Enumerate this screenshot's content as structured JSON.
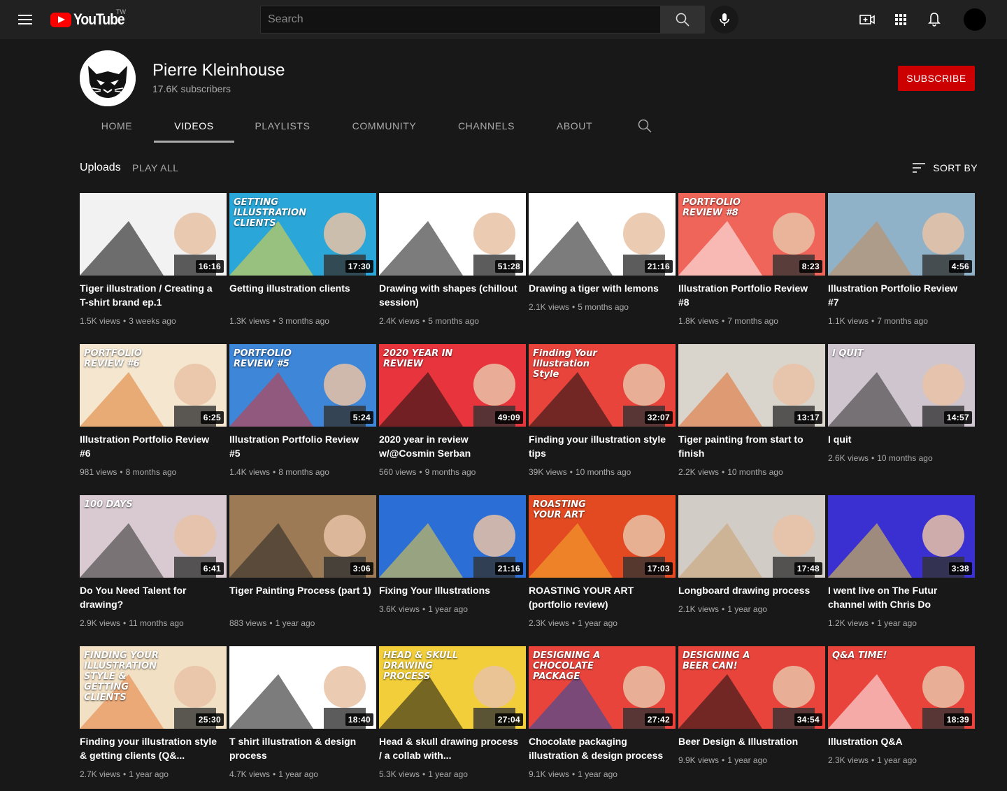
{
  "topbar": {
    "logo_text": "YouTube",
    "region": "TW",
    "search_placeholder": "Search"
  },
  "channel": {
    "name": "Pierre Kleinhouse",
    "subscribers": "17.6K subscribers",
    "subscribe_label": "SUBSCRIBE"
  },
  "tabs": [
    {
      "label": "HOME",
      "active": false
    },
    {
      "label": "VIDEOS",
      "active": true
    },
    {
      "label": "PLAYLISTS",
      "active": false
    },
    {
      "label": "COMMUNITY",
      "active": false
    },
    {
      "label": "CHANNELS",
      "active": false
    },
    {
      "label": "ABOUT",
      "active": false
    }
  ],
  "uploads": {
    "title": "Uploads",
    "play_all": "PLAY ALL",
    "sort_by": "SORT BY"
  },
  "videos": [
    {
      "title": "Tiger illustration / Creating a T-shirt brand ep.1",
      "views": "1.5K views",
      "age": "3 weeks ago",
      "duration": "16:16",
      "thumb_bg": "#f2f2f2",
      "thumb_accent": "#000000",
      "thumb_text": ""
    },
    {
      "title": "Getting illustration clients",
      "views": "1.3K views",
      "age": "3 months ago",
      "duration": "17:30",
      "thumb_bg": "#2aa7d8",
      "thumb_accent": "#f2d636",
      "thumb_text": "GETTING ILLUSTRATION CLIENTS"
    },
    {
      "title": "Drawing with shapes (chillout session)",
      "views": "2.4K views",
      "age": "5 months ago",
      "duration": "51:28",
      "thumb_bg": "#ffffff",
      "thumb_accent": "#111111",
      "thumb_text": ""
    },
    {
      "title": "Drawing a tiger with lemons",
      "views": "2.1K views",
      "age": "5 months ago",
      "duration": "21:16",
      "thumb_bg": "#ffffff",
      "thumb_accent": "#111111",
      "thumb_text": ""
    },
    {
      "title": "Illustration Portfolio Review #8",
      "views": "1.8K views",
      "age": "7 months ago",
      "duration": "8:23",
      "thumb_bg": "#f0655a",
      "thumb_accent": "#ffffff",
      "thumb_text": "PORTFOLIO REVIEW #8"
    },
    {
      "title": "Illustration Portfolio Review #7",
      "views": "1.1K views",
      "age": "7 months ago",
      "duration": "4:56",
      "thumb_bg": "#8fb2c9",
      "thumb_accent": "#c68a55",
      "thumb_text": ""
    },
    {
      "title": "Illustration Portfolio Review #6",
      "views": "981 views",
      "age": "8 months ago",
      "duration": "6:25",
      "thumb_bg": "#f4e6cf",
      "thumb_accent": "#e07a2c",
      "thumb_text": "PORTFOLIO REVIEW #6"
    },
    {
      "title": "Illustration Portfolio Review #5",
      "views": "1.4K views",
      "age": "8 months ago",
      "duration": "5:24",
      "thumb_bg": "#3d86d8",
      "thumb_accent": "#d73434",
      "thumb_text": "PORTFOLIO REVIEW #5"
    },
    {
      "title": "2020 year in review w/@Cosmin Serban",
      "views": "560 views",
      "age": "9 months ago",
      "duration": "49:09",
      "thumb_bg": "#e8343c",
      "thumb_accent": "#111111",
      "thumb_text": "2020 YEAR IN REVIEW"
    },
    {
      "title": "Finding your illustration style tips",
      "views": "39K views",
      "age": "10 months ago",
      "duration": "32:07",
      "thumb_bg": "#e8443c",
      "thumb_accent": "#111111",
      "thumb_text": "Finding Your Illustration Style"
    },
    {
      "title": "Tiger painting from start to finish",
      "views": "2.2K views",
      "age": "10 months ago",
      "duration": "13:17",
      "thumb_bg": "#d9d4cc",
      "thumb_accent": "#e06a2a",
      "thumb_text": ""
    },
    {
      "title": "I quit",
      "views": "2.6K views",
      "age": "10 months ago",
      "duration": "14:57",
      "thumb_bg": "#cfc5cf",
      "thumb_accent": "#2b2b2b",
      "thumb_text": "I QUIT"
    },
    {
      "title": "Do You Need Talent for drawing?",
      "views": "2.9K views",
      "age": "11 months ago",
      "duration": "6:41",
      "thumb_bg": "#d8cad0",
      "thumb_accent": "#2b2b2b",
      "thumb_text": "100 DAYS"
    },
    {
      "title": "Tiger Painting Process (part 1)",
      "views": "883 views",
      "age": "1 year ago",
      "duration": "3:06",
      "thumb_bg": "#9c7a55",
      "thumb_accent": "#222222",
      "thumb_text": ""
    },
    {
      "title": "Fixing Your Illustrations",
      "views": "3.6K views",
      "age": "1 year ago",
      "duration": "21:16",
      "thumb_bg": "#2b6fd6",
      "thumb_accent": "#f2d03c",
      "thumb_text": ""
    },
    {
      "title": "ROASTING YOUR ART (portfolio review)",
      "views": "2.3K views",
      "age": "1 year ago",
      "duration": "17:03",
      "thumb_bg": "#e44a22",
      "thumb_accent": "#f6b030",
      "thumb_text": "ROASTING YOUR ART"
    },
    {
      "title": "Longboard drawing process",
      "views": "2.1K views",
      "age": "1 year ago",
      "duration": "17:48",
      "thumb_bg": "#d2ccc6",
      "thumb_accent": "#caa070",
      "thumb_text": ""
    },
    {
      "title": "I went live on The Futur channel with Chris Do",
      "views": "1.2K views",
      "age": "1 year ago",
      "duration": "3:38",
      "thumb_bg": "#3a2fd0",
      "thumb_accent": "#f3d63a",
      "thumb_text": ""
    },
    {
      "title": "Finding your illustration style & getting clients (Q&...",
      "views": "2.7K views",
      "age": "1 year ago",
      "duration": "25:30",
      "thumb_bg": "#f2e0c4",
      "thumb_accent": "#e57c3a",
      "thumb_text": "FINDING YOUR ILLUSTRATION STYLE & GETTING CLIENTS"
    },
    {
      "title": "T shirt illustration & design process",
      "views": "4.7K views",
      "age": "1 year ago",
      "duration": "18:40",
      "thumb_bg": "#ffffff",
      "thumb_accent": "#111111",
      "thumb_text": ""
    },
    {
      "title": "Head & skull drawing process / a collab with...",
      "views": "5.3K views",
      "age": "1 year ago",
      "duration": "27:04",
      "thumb_bg": "#f2cf3a",
      "thumb_accent": "#111111",
      "thumb_text": "HEAD & SKULL DRAWING PROCESS"
    },
    {
      "title": "Chocolate packaging illustration & design process",
      "views": "9.1K views",
      "age": "1 year ago",
      "duration": "27:42",
      "thumb_bg": "#e8443c",
      "thumb_accent": "#1f4fa8",
      "thumb_text": "DESIGNING A CHOCOLATE PACKAGE"
    },
    {
      "title": "Beer Design & Illustration",
      "views": "9.9K views",
      "age": "1 year ago",
      "duration": "34:54",
      "thumb_bg": "#e8443c",
      "thumb_accent": "#111111",
      "thumb_text": "DESIGNING A BEER CAN!"
    },
    {
      "title": "Illustration Q&A",
      "views": "2.3K views",
      "age": "1 year ago",
      "duration": "18:39",
      "thumb_bg": "#e8443c",
      "thumb_accent": "#ffffff",
      "thumb_text": "Q&A TIME!"
    }
  ]
}
